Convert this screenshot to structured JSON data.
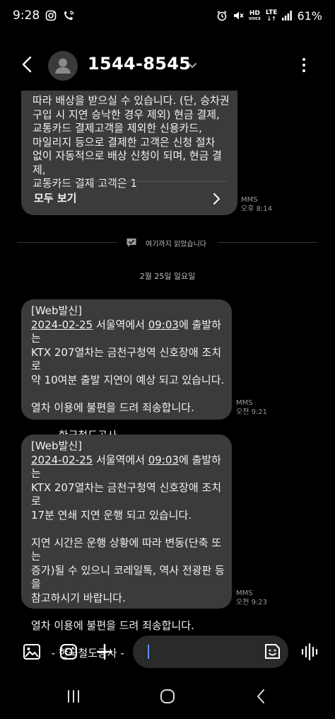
{
  "status_bar": {
    "time": "9:28",
    "battery": "61%",
    "hd_line1": "HD",
    "hd_line2": "VOICE",
    "lte_line1": "LTE",
    "lte_line2": "↓↑"
  },
  "header": {
    "contact": "1544-8545"
  },
  "messages": [
    {
      "text": "따라 배상을 받으실 수 있습니다. (단, 승차권\n구입 시 지연 승낙한 경우 제외) 현금 결제,\n교통카드 결제고객을 제외한 신용카드,\n마일리지 등으로 결제한 고객은 신청 절차\n없이 자동적으로 배상 신청이 되며, 현금 결제,\n교통카드 결제 고객은 1",
      "see_all": "모두 보기",
      "type": "MMS",
      "time": "오후 8:14"
    },
    {
      "tag": "[Web발신]",
      "date": "2024-02-25",
      "mid1": " 서울역에서 ",
      "clock": "09:03",
      "rest": "에 출발하는\nKTX 207열차는 금천구청역 신호장애 조치로\n약 10여분 출발 지연이 예상 되고 있습니다.\n\n열차 이용에 불편을 드려 죄송합니다.\n\n      - 한국철도공사 -",
      "type": "MMS",
      "time": "오전 9:21"
    },
    {
      "tag": "[Web발신]",
      "date": "2024-02-25",
      "mid1": " 서울역에서 ",
      "clock": "09:03",
      "rest": "에 출발하는\nKTX 207열차는 금천구청역 신호장애 조치로\n17분 연쇄 지연 운행 되고 있습니다.\n\n지연 시간은 운행 상황에 따라 변동(단축 또는\n증가)될 수 있으니 코레일톡, 역사 전광판 등을\n참고하시기 바랍니다.\n\n열차 이용에 불편을 드려 죄송합니다.\n\n      - 한국철도공사 -",
      "type": "MMS",
      "time": "오전 9:23"
    }
  ],
  "read_marker": "여기까지 읽었습니다",
  "date_separator": "2월 25일 일요일",
  "input": {
    "placeholder": ""
  },
  "colors": {
    "bubble": "#3b3b3b",
    "accent": "#5a8dff",
    "meta": "#9a9a9a"
  }
}
